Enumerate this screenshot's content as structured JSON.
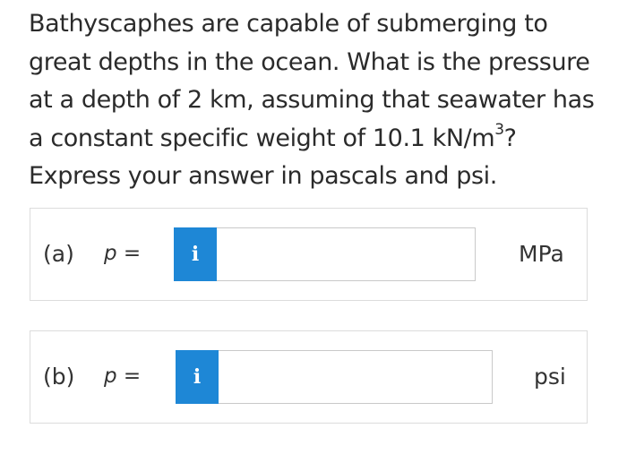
{
  "question": {
    "text_main": "Bathyscaphes are capable of submerging to great depths in the ocean. What is the pressure at a depth of 2 km, assuming that seawater has a constant specific weight of 10.1 kN/m",
    "text_sup": "3",
    "text_end": "? Express your answer in pascals and psi."
  },
  "parts": [
    {
      "label": "(a)",
      "variable": "p",
      "equals": "=",
      "info_glyph": "i",
      "input_value": "",
      "unit": "MPa"
    },
    {
      "label": "(b)",
      "variable": "p",
      "equals": "=",
      "info_glyph": "i",
      "input_value": "",
      "unit": "psi"
    }
  ],
  "colors": {
    "info_button": "#1e87d6",
    "text": "#2b2b2b",
    "box_border": "#dcdcdc"
  },
  "icons": {
    "info": "info-icon"
  }
}
